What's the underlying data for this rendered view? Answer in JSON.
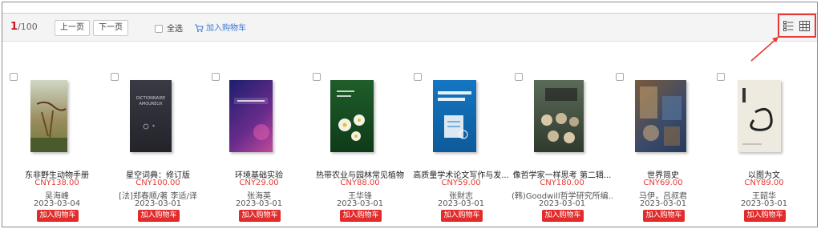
{
  "toolbar": {
    "page_current": "1",
    "page_total": "/100",
    "prev_label": "上一页",
    "next_label": "下一页",
    "select_all_label": "全选",
    "add_to_cart_label": "加入购物车",
    "view_list_icon": "list-view-icon",
    "view_grid_icon": "grid-view-icon"
  },
  "colors": {
    "accent_red": "#e53935",
    "link_blue": "#3a7bd5",
    "toolbar_bg": "#f4f4f4"
  },
  "books": [
    {
      "title": "东非野生动物手册",
      "price": "CNY138.00",
      "author": "吴海峰",
      "date": "2023-03-04",
      "cart": "加入购物车"
    },
    {
      "title": "星空词典：修订版",
      "price": "CNY100.00",
      "author": "[法]郑春顺/著 李适/译",
      "date": "2023-03-01",
      "cart": "加入购物车"
    },
    {
      "title": "环境基础实验",
      "price": "CNY29.00",
      "author": "张海英",
      "date": "2023-03-01",
      "cart": "加入购物车"
    },
    {
      "title": "热带农业与园林常见植物",
      "price": "CNY88.00",
      "author": "王华锋",
      "date": "2023-03-01",
      "cart": "加入购物车"
    },
    {
      "title": "高质量学术论文写作与发...",
      "price": "CNY59.00",
      "author": "张財志",
      "date": "2023-03-01",
      "cart": "加入购物车"
    },
    {
      "title": "像哲学家一样思考 第二辑...",
      "price": "CNY180.00",
      "author": "(韩)Goodwill哲学研究所编...",
      "date": "2023-03-01",
      "cart": "加入购物车"
    },
    {
      "title": "世界简史",
      "price": "CNY69.00",
      "author": "马伊，吕叔君",
      "date": "2023-03-01",
      "cart": "加入购物车"
    },
    {
      "title": "以图为文",
      "price": "CNY89.00",
      "author": "王韶华",
      "date": "2023-03-01",
      "cart": "加入购物车"
    }
  ]
}
